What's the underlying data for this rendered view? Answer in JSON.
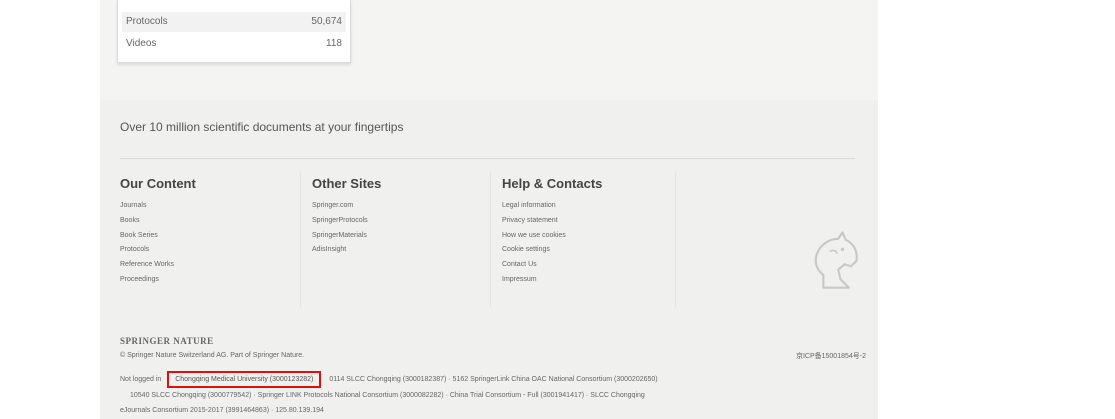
{
  "counts": [
    {
      "label": "Protocols",
      "value": "50,674"
    },
    {
      "label": "Videos",
      "value": "118"
    }
  ],
  "footer": {
    "tagline": "Over 10 million scientific documents at your fingertips",
    "columns": [
      {
        "heading": "Our Content",
        "links": [
          "Journals",
          "Books",
          "Book Series",
          "Protocols",
          "Reference Works",
          "Proceedings"
        ]
      },
      {
        "heading": "Other Sites",
        "links": [
          "Springer.com",
          "SpringerProtocols",
          "SpringerMaterials",
          "AdisInsight"
        ]
      },
      {
        "heading": "Help & Contacts",
        "links": [
          "Legal information",
          "Privacy statement",
          "How we use cookies",
          "Cookie settings",
          "Contact Us",
          "Impressum"
        ]
      }
    ],
    "brand": "SPRINGER NATURE",
    "copyright": "© Springer Nature Switzerland AG. Part of Springer Nature.",
    "icp": "京ICP备15001854号-2",
    "not_logged_in": "Not logged in",
    "institution": "Chongqing Medical University (3000123282)",
    "access_1": "0114 SLCC Chongqing (3000182387) · 5162 SpringerLink China OAC National Consortium (3000202650)",
    "access_2": "10540 SLCC Chongqing (3000779542) · Springer LINK Protocols National Consortium (3000082282) · China Trial Consortium - Full (3001941417) · SLCC Chongqing",
    "access_3": "eJournals Consortium 2015-2017 (3991464863) · 125.80.139.194"
  }
}
